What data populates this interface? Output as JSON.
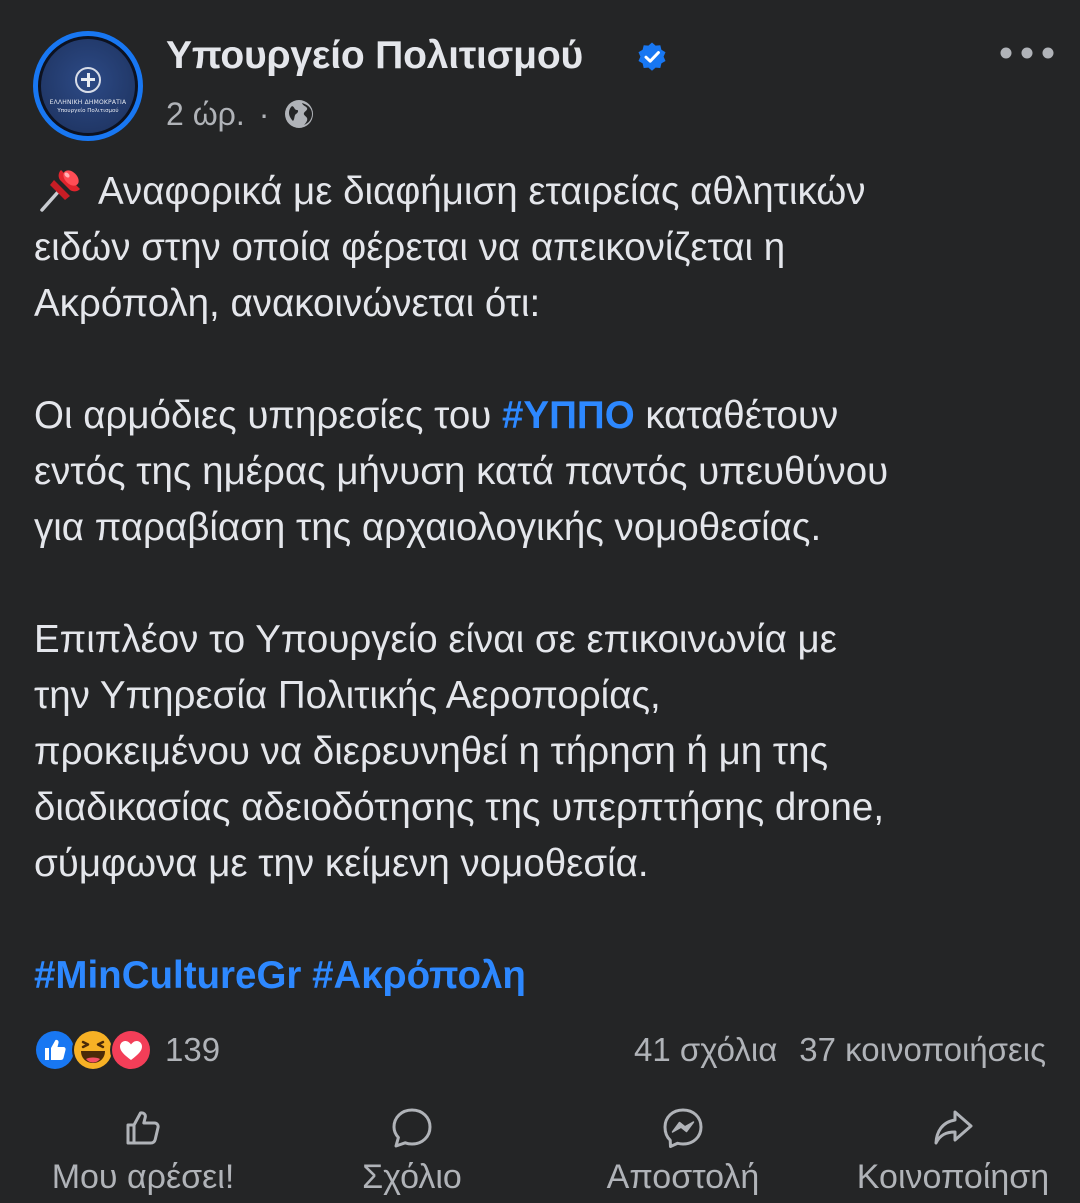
{
  "post": {
    "page_name": "Υπουργείο Πολιτισμού",
    "verified_icon": "verified-badge-icon",
    "timestamp": "2 ώρ.",
    "separator": "·",
    "audience_icon": "globe-icon",
    "avatar": {
      "line1": "ΕΛΛΗΝΙΚΗ ΔΗΜΟΚΡΑΤΙΑ",
      "line2": "Υπουργείο Πολιτισμού"
    },
    "more_icon": "more-options-icon",
    "body": {
      "pin_icon": "pushpin-emoji",
      "p1_lines": [
        "Αναφορικά με διαφήμιση εταιρείας αθλητικών",
        "ειδών στην οποία φέρεται να απεικονίζεται η",
        "Ακρόπολη, ανακοινώνεται ότι:"
      ],
      "p2_line1_before": "Οι αρμόδιες υπηρεσίες του ",
      "p2_hashtag": "#ΥΠΠΟ",
      "p2_line1_after": " καταθέτουν",
      "p2_lines": [
        "εντός της ημέρας μήνυση κατά παντός υπευθύνου",
        "για παραβίαση της αρχαιολογικής νομοθεσίας."
      ],
      "p3_lines": [
        "Επιπλέον το Υπουργείο είναι σε επικοινωνία με",
        "την Υπηρεσία Πολιτικής Αεροπορίας,",
        "προκειμένου να διερευνηθεί η τήρηση ή μη της",
        "διαδικασίας αδειοδότησης της υπερπτήσης drone,",
        "σύμφωνα με την κείμενη νομοθεσία."
      ],
      "hashtags": [
        "#MinCultureGr",
        "#Ακρόπολη"
      ]
    },
    "stats": {
      "reaction_icons": [
        "like-reaction-icon",
        "haha-reaction-icon",
        "love-reaction-icon"
      ],
      "reaction_count": "139",
      "comments": "41 σχόλια",
      "shares": "37 κοινοποιήσεις"
    },
    "actions": {
      "like": "Μου αρέσει!",
      "comment": "Σχόλιο",
      "send": "Αποστολή",
      "share": "Κοινοποίηση"
    },
    "colors": {
      "background": "#242526",
      "text": "#e4e6eb",
      "secondary_text": "#b0b3b8",
      "link": "#2d88ff",
      "verified": "#1877f2",
      "love": "#f33e58",
      "haha": "#f7b125"
    }
  }
}
